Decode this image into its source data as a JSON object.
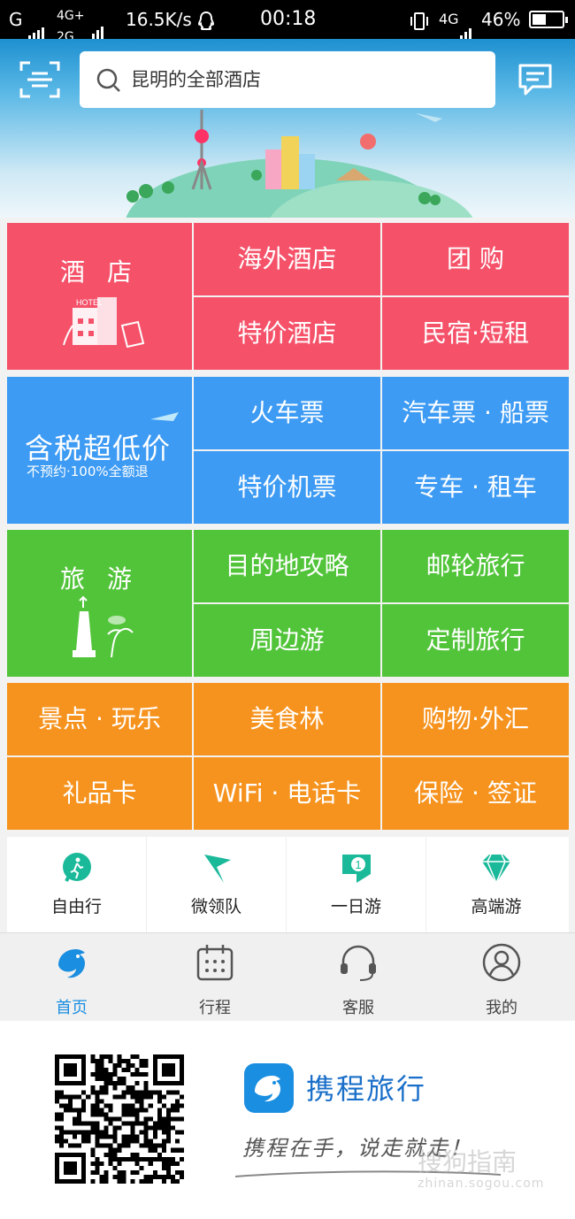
{
  "status_bar": {
    "carrier_left": "G",
    "net_top": "4G+",
    "net_bottom": "2G",
    "speed": "16.5K/s",
    "time": "00:18",
    "net_right": "4G",
    "battery_percent": "46%",
    "battery_level": 0.46
  },
  "header": {
    "search_placeholder": "昆明的全部酒店",
    "scan_icon": "scan-icon",
    "message_icon": "message-icon"
  },
  "grid": {
    "hotel": {
      "main_label": "酒 店",
      "sign_text": "HOTEL",
      "items": [
        "海外酒店",
        "团 购",
        "特价酒店",
        "民宿·短租"
      ]
    },
    "transport": {
      "promo_title": "含税超低价",
      "promo_sub": "不预约·100%全额退",
      "items": [
        "火车票",
        "汽车票 · 船票",
        "特价机票",
        "专车 · 租车"
      ]
    },
    "travel": {
      "main_label": "旅 游",
      "items": [
        "目的地攻略",
        "邮轮旅行",
        "周边游",
        "定制旅行"
      ]
    },
    "more": {
      "items": [
        "景点 · 玩乐",
        "美食林",
        "购物·外汇",
        "礼品卡",
        "WiFi · 电话卡",
        "保险 · 签证"
      ]
    }
  },
  "quick_links": [
    {
      "label": "自由行",
      "icon": "walker-icon"
    },
    {
      "label": "微领队",
      "icon": "flag-icon"
    },
    {
      "label": "一日游",
      "icon": "one-day-flag-icon"
    },
    {
      "label": "高端游",
      "icon": "diamond-icon"
    }
  ],
  "quick_badge": "1",
  "tabs": [
    {
      "label": "首页",
      "icon": "dolphin-icon",
      "active": true
    },
    {
      "label": "行程",
      "icon": "calendar-icon",
      "active": false
    },
    {
      "label": "客服",
      "icon": "headset-icon",
      "active": false
    },
    {
      "label": "我的",
      "icon": "user-icon",
      "active": false
    }
  ],
  "footer": {
    "brand_name": "携程旅行",
    "slogan": "携程在手，说走就走！",
    "watermark": "搜狗指南",
    "watermark_url": "zhinan.sogou.com"
  },
  "colors": {
    "red": "#f5526a",
    "blue": "#3d9bf4",
    "green": "#52c43a",
    "orange": "#f6931e",
    "brand": "#1a8ee0"
  }
}
